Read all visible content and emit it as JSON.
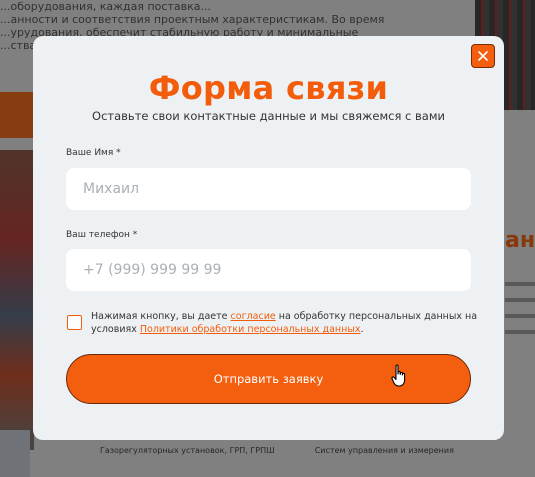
{
  "background": {
    "text_lines": [
      "...оборудования, каждая поставка...",
      "...анности и соответствия проектным характеристикам. Во время",
      "...урудования, обеспечит стабильную работу и минимальные",
      "...ства"
    ],
    "bottom_items": [
      "Газорегуляторных установок, ГРП, ГРПШ",
      "Систем управления и измерения"
    ]
  },
  "modal": {
    "title": "Форма связи",
    "subtitle": "Оставьте свои контактные данные и мы свяжемся с вами",
    "name_label": "Ваше Имя *",
    "name_placeholder": "Михаил",
    "phone_label": "Ваш телефон *",
    "phone_placeholder": "+7 (999) 999 99 99",
    "consent_text_1": "Нажимая кнопку, вы даете ",
    "consent_link_1": "согласие",
    "consent_text_2": " на обработку персональных данных на условиях ",
    "consent_link_2": "Политики обработки персональных данных",
    "consent_text_3": ".",
    "submit_label": "Отправить заявку",
    "close_icon": "close-icon"
  },
  "colors": {
    "accent": "#f25c0a",
    "modal_bg": "#eef1f4",
    "field_bg": "#ffffff"
  }
}
